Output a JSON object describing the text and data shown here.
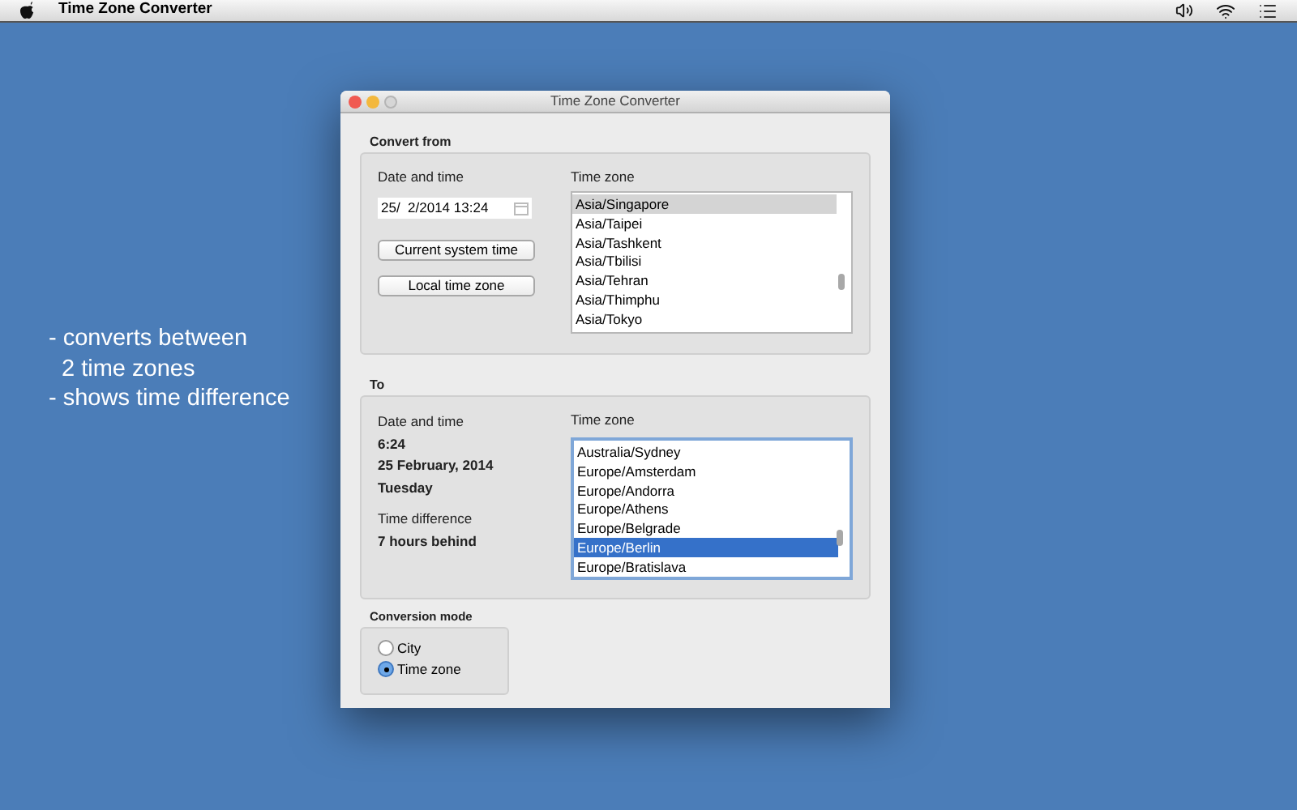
{
  "menu_bar": {
    "app_name": "Time Zone Converter"
  },
  "caption": [
    "- converts between",
    "2 time zones",
    "- shows time difference"
  ],
  "window": {
    "title": "Time Zone Converter"
  },
  "convert_from": {
    "title": "Convert from",
    "date_label": "Date and time",
    "date_value": "25/  2/2014 13:24",
    "buttons": [
      "Current system time",
      "Local time zone"
    ],
    "zone_label": "Time zone",
    "focused": false,
    "zones": [
      {
        "label": "Asia/Singapore",
        "selected": true
      },
      {
        "label": "Asia/Taipei",
        "selected": false
      },
      {
        "label": "Asia/Tashkent",
        "selected": false
      },
      {
        "label": "Asia/Tbilisi",
        "selected": false
      },
      {
        "label": "Asia/Tehran",
        "selected": false
      },
      {
        "label": "Asia/Thimphu",
        "selected": false
      },
      {
        "label": "Asia/Tokyo",
        "selected": false
      }
    ]
  },
  "to": {
    "title": "To",
    "date_label": "Date and time",
    "time": "6:24",
    "date": "25 February, 2014",
    "weekday": "Tuesday",
    "difference_label": "Time difference",
    "difference": "7 hours behind",
    "zone_label": "Time zone",
    "focused": true,
    "zones": [
      {
        "label": "Australia/Sydney",
        "selected": false
      },
      {
        "label": "Europe/Amsterdam",
        "selected": false
      },
      {
        "label": "Europe/Andorra",
        "selected": false
      },
      {
        "label": "Europe/Athens",
        "selected": false
      },
      {
        "label": "Europe/Belgrade",
        "selected": false
      },
      {
        "label": "Europe/Berlin",
        "selected": true
      },
      {
        "label": "Europe/Bratislava",
        "selected": false
      }
    ]
  },
  "conversion_mode": {
    "title": "Conversion mode",
    "options": [
      {
        "label": "City",
        "selected": false
      },
      {
        "label": "Time zone",
        "selected": true
      }
    ]
  }
}
